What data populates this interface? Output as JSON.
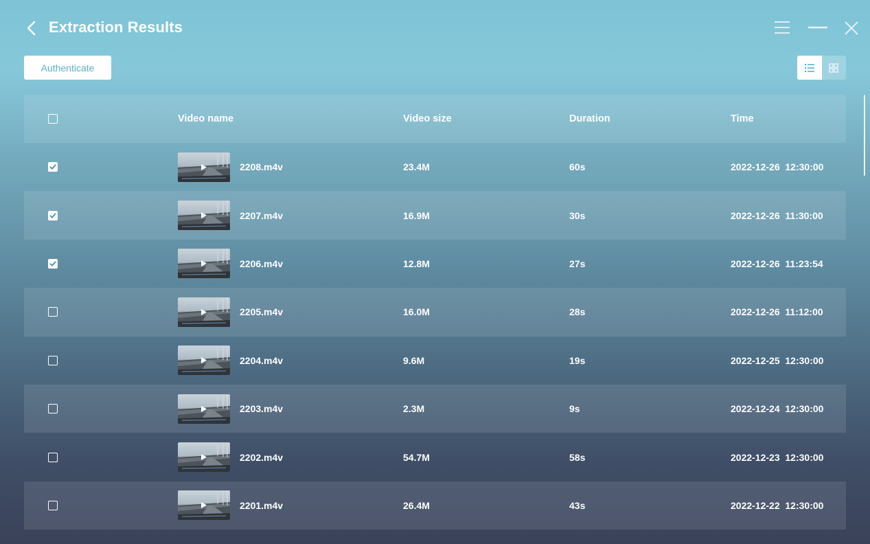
{
  "header": {
    "title": "Extraction Results"
  },
  "toolbar": {
    "authenticate_label": "Authenticate"
  },
  "table": {
    "columns": {
      "name": "Video name",
      "size": "Video size",
      "duration": "Duration",
      "time": "Time"
    },
    "rows": [
      {
        "name": "2208.m4v",
        "size": "23.4M",
        "duration": "60s",
        "time": "2022-12-26  12:30:00",
        "checked": true
      },
      {
        "name": "2207.m4v",
        "size": "16.9M",
        "duration": "30s",
        "time": "2022-12-26  11:30:00",
        "checked": true
      },
      {
        "name": "2206.m4v",
        "size": "12.8M",
        "duration": "27s",
        "time": "2022-12-26  11:23:54",
        "checked": true
      },
      {
        "name": "2205.m4v",
        "size": "16.0M",
        "duration": "28s",
        "time": "2022-12-26  11:12:00",
        "checked": false
      },
      {
        "name": "2204.m4v",
        "size": "9.6M",
        "duration": "19s",
        "time": "2022-12-25  12:30:00",
        "checked": false
      },
      {
        "name": "2203.m4v",
        "size": "2.3M",
        "duration": "9s",
        "time": "2022-12-24  12:30:00",
        "checked": false
      },
      {
        "name": "2202.m4v",
        "size": "54.7M",
        "duration": "58s",
        "time": "2022-12-23  12:30:00",
        "checked": false
      },
      {
        "name": "2201.m4v",
        "size": "26.4M",
        "duration": "43s",
        "time": "2022-12-22  12:30:00",
        "checked": false
      }
    ]
  },
  "colors": {
    "accent": "#5ab0c6",
    "check_color": "#4e8fa3"
  }
}
